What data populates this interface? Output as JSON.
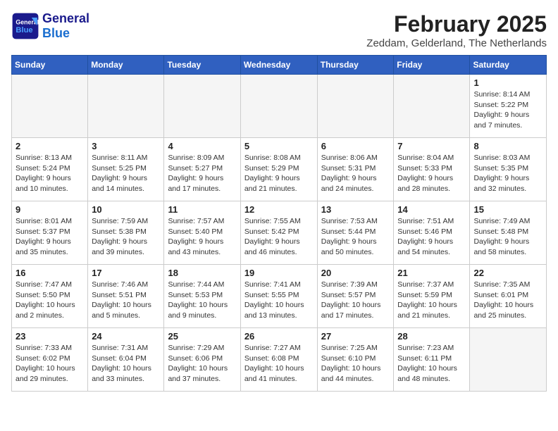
{
  "header": {
    "logo_general": "General",
    "logo_blue": "Blue",
    "month_year": "February 2025",
    "location": "Zeddam, Gelderland, The Netherlands"
  },
  "weekdays": [
    "Sunday",
    "Monday",
    "Tuesday",
    "Wednesday",
    "Thursday",
    "Friday",
    "Saturday"
  ],
  "weeks": [
    [
      {
        "day": "",
        "info": ""
      },
      {
        "day": "",
        "info": ""
      },
      {
        "day": "",
        "info": ""
      },
      {
        "day": "",
        "info": ""
      },
      {
        "day": "",
        "info": ""
      },
      {
        "day": "",
        "info": ""
      },
      {
        "day": "1",
        "info": "Sunrise: 8:14 AM\nSunset: 5:22 PM\nDaylight: 9 hours\nand 7 minutes."
      }
    ],
    [
      {
        "day": "2",
        "info": "Sunrise: 8:13 AM\nSunset: 5:24 PM\nDaylight: 9 hours\nand 10 minutes."
      },
      {
        "day": "3",
        "info": "Sunrise: 8:11 AM\nSunset: 5:25 PM\nDaylight: 9 hours\nand 14 minutes."
      },
      {
        "day": "4",
        "info": "Sunrise: 8:09 AM\nSunset: 5:27 PM\nDaylight: 9 hours\nand 17 minutes."
      },
      {
        "day": "5",
        "info": "Sunrise: 8:08 AM\nSunset: 5:29 PM\nDaylight: 9 hours\nand 21 minutes."
      },
      {
        "day": "6",
        "info": "Sunrise: 8:06 AM\nSunset: 5:31 PM\nDaylight: 9 hours\nand 24 minutes."
      },
      {
        "day": "7",
        "info": "Sunrise: 8:04 AM\nSunset: 5:33 PM\nDaylight: 9 hours\nand 28 minutes."
      },
      {
        "day": "8",
        "info": "Sunrise: 8:03 AM\nSunset: 5:35 PM\nDaylight: 9 hours\nand 32 minutes."
      }
    ],
    [
      {
        "day": "9",
        "info": "Sunrise: 8:01 AM\nSunset: 5:37 PM\nDaylight: 9 hours\nand 35 minutes."
      },
      {
        "day": "10",
        "info": "Sunrise: 7:59 AM\nSunset: 5:38 PM\nDaylight: 9 hours\nand 39 minutes."
      },
      {
        "day": "11",
        "info": "Sunrise: 7:57 AM\nSunset: 5:40 PM\nDaylight: 9 hours\nand 43 minutes."
      },
      {
        "day": "12",
        "info": "Sunrise: 7:55 AM\nSunset: 5:42 PM\nDaylight: 9 hours\nand 46 minutes."
      },
      {
        "day": "13",
        "info": "Sunrise: 7:53 AM\nSunset: 5:44 PM\nDaylight: 9 hours\nand 50 minutes."
      },
      {
        "day": "14",
        "info": "Sunrise: 7:51 AM\nSunset: 5:46 PM\nDaylight: 9 hours\nand 54 minutes."
      },
      {
        "day": "15",
        "info": "Sunrise: 7:49 AM\nSunset: 5:48 PM\nDaylight: 9 hours\nand 58 minutes."
      }
    ],
    [
      {
        "day": "16",
        "info": "Sunrise: 7:47 AM\nSunset: 5:50 PM\nDaylight: 10 hours\nand 2 minutes."
      },
      {
        "day": "17",
        "info": "Sunrise: 7:46 AM\nSunset: 5:51 PM\nDaylight: 10 hours\nand 5 minutes."
      },
      {
        "day": "18",
        "info": "Sunrise: 7:44 AM\nSunset: 5:53 PM\nDaylight: 10 hours\nand 9 minutes."
      },
      {
        "day": "19",
        "info": "Sunrise: 7:41 AM\nSunset: 5:55 PM\nDaylight: 10 hours\nand 13 minutes."
      },
      {
        "day": "20",
        "info": "Sunrise: 7:39 AM\nSunset: 5:57 PM\nDaylight: 10 hours\nand 17 minutes."
      },
      {
        "day": "21",
        "info": "Sunrise: 7:37 AM\nSunset: 5:59 PM\nDaylight: 10 hours\nand 21 minutes."
      },
      {
        "day": "22",
        "info": "Sunrise: 7:35 AM\nSunset: 6:01 PM\nDaylight: 10 hours\nand 25 minutes."
      }
    ],
    [
      {
        "day": "23",
        "info": "Sunrise: 7:33 AM\nSunset: 6:02 PM\nDaylight: 10 hours\nand 29 minutes."
      },
      {
        "day": "24",
        "info": "Sunrise: 7:31 AM\nSunset: 6:04 PM\nDaylight: 10 hours\nand 33 minutes."
      },
      {
        "day": "25",
        "info": "Sunrise: 7:29 AM\nSunset: 6:06 PM\nDaylight: 10 hours\nand 37 minutes."
      },
      {
        "day": "26",
        "info": "Sunrise: 7:27 AM\nSunset: 6:08 PM\nDaylight: 10 hours\nand 41 minutes."
      },
      {
        "day": "27",
        "info": "Sunrise: 7:25 AM\nSunset: 6:10 PM\nDaylight: 10 hours\nand 44 minutes."
      },
      {
        "day": "28",
        "info": "Sunrise: 7:23 AM\nSunset: 6:11 PM\nDaylight: 10 hours\nand 48 minutes."
      },
      {
        "day": "",
        "info": ""
      }
    ]
  ]
}
